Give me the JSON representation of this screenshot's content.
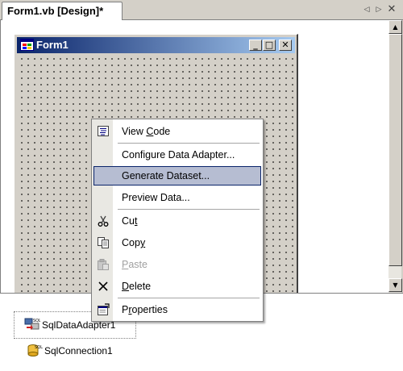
{
  "tab": {
    "title": "Form1.vb [Design]*",
    "prev_glyph": "◁",
    "next_glyph": "▷",
    "close_glyph": "✕"
  },
  "scrollbar": {
    "up_glyph": "▲",
    "down_glyph": "▼"
  },
  "form": {
    "title": "Form1",
    "icon": "form-window-icon",
    "buttons": {
      "minimize": "_",
      "maximize": "□",
      "close": "✕"
    }
  },
  "context_menu": {
    "items": [
      {
        "label": "View Code",
        "mnemonic_index": 5,
        "icon": "view-code-icon"
      },
      {
        "label": "Configure Data Adapter...",
        "icon": "none"
      },
      {
        "label": "Generate Dataset...",
        "icon": "none",
        "highlighted": true
      },
      {
        "label": "Preview Data...",
        "icon": "none"
      },
      {
        "label": "Cut",
        "mnemonic_index": 2,
        "icon": "scissors-icon"
      },
      {
        "label": "Copy",
        "mnemonic_index": 3,
        "icon": "copy-icon"
      },
      {
        "label": "Paste",
        "mnemonic_index": 0,
        "icon": "paste-icon",
        "disabled": true
      },
      {
        "label": "Delete",
        "mnemonic_index": 0,
        "icon": "delete-icon"
      },
      {
        "label": "Properties",
        "mnemonic_index": 1,
        "icon": "properties-icon"
      }
    ]
  },
  "tray": {
    "components": [
      {
        "label": "SqlDataAdapter1",
        "icon": "sql-data-adapter-icon",
        "selected": true
      },
      {
        "label": "SqlConnection1",
        "icon": "sql-connection-icon"
      }
    ]
  },
  "colors": {
    "titlebar_start": "#0a246a",
    "titlebar_end": "#a6caf0",
    "menu_highlight": "#b6bdd2",
    "menu_highlight_border": "#0a246a"
  }
}
